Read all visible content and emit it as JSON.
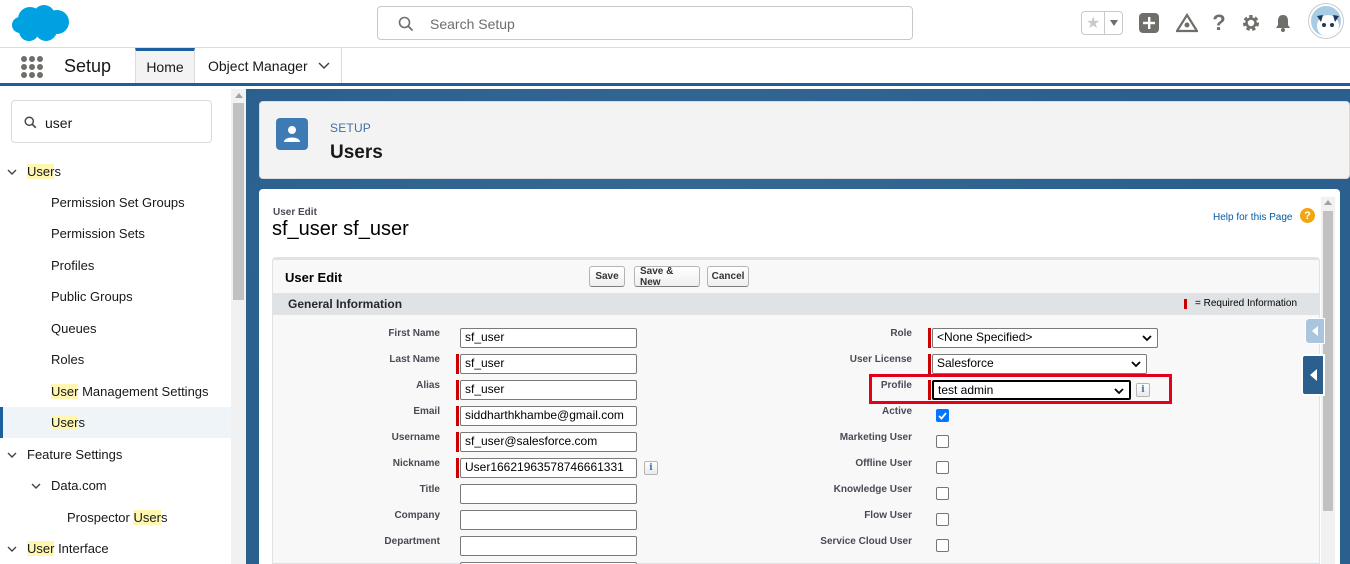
{
  "header": {
    "search_placeholder": "Search Setup",
    "icons": [
      "favorites-star-icon",
      "add-icon",
      "trailhead-icon",
      "help-icon",
      "gear-icon",
      "bell-icon",
      "avatar"
    ]
  },
  "nav": {
    "app_name": "Setup",
    "tabs": [
      {
        "label": "Home",
        "active": true
      },
      {
        "label": "Object Manager",
        "active": false
      }
    ]
  },
  "sidebar": {
    "search_value": "user",
    "items": [
      {
        "label_hl": "User",
        "label_rest": "s",
        "level": 0,
        "expanded": true
      },
      {
        "label": "Permission Set Groups",
        "level": 1
      },
      {
        "label": "Permission Sets",
        "level": 1
      },
      {
        "label": "Profiles",
        "level": 1
      },
      {
        "label": "Public Groups",
        "level": 1
      },
      {
        "label": "Queues",
        "level": 1
      },
      {
        "label": "Roles",
        "level": 1
      },
      {
        "label_hl": "User",
        "label_rest": " Management Settings",
        "level": 1
      },
      {
        "label_hl": "User",
        "label_rest": "s",
        "level": 1,
        "active": true
      },
      {
        "label": "Feature Settings",
        "level": 0,
        "expanded": true
      },
      {
        "label": "Data.com",
        "level": 1,
        "expanded": true
      },
      {
        "label_pre": "Prospector ",
        "label_hl": "User",
        "label_rest": "s",
        "level": 2
      },
      {
        "label_hl": "User",
        "label_rest": " Interface",
        "level": 0,
        "expanded": true
      }
    ]
  },
  "page_header": {
    "eyebrow": "SETUP",
    "title": "Users"
  },
  "form": {
    "subtitle": "User Edit",
    "name": "sf_user sf_user",
    "help_link": "Help for this Page",
    "block_title": "User Edit",
    "buttons": {
      "save": "Save",
      "save_new": "Save & New",
      "cancel": "Cancel"
    },
    "section_title": "General Information",
    "required_info": "= Required Information",
    "left_fields": [
      {
        "label": "First Name",
        "value": "sf_user",
        "required": false
      },
      {
        "label": "Last Name",
        "value": "sf_user",
        "required": true
      },
      {
        "label": "Alias",
        "value": "sf_user",
        "required": true
      },
      {
        "label": "Email",
        "value": "siddharthkhambe@gmail.com",
        "required": true
      },
      {
        "label": "Username",
        "value": "sf_user@salesforce.com",
        "required": true
      },
      {
        "label": "Nickname",
        "value": "User16621963578746661331",
        "required": true,
        "info": true
      },
      {
        "label": "Title",
        "value": "",
        "required": false
      },
      {
        "label": "Company",
        "value": "",
        "required": false
      },
      {
        "label": "Department",
        "value": "",
        "required": false
      }
    ],
    "right_fields": {
      "role": {
        "label": "Role",
        "value": "<None Specified>"
      },
      "user_license": {
        "label": "User License",
        "value": "Salesforce"
      },
      "profile": {
        "label": "Profile",
        "value": "test admin"
      },
      "checkboxes": [
        {
          "label": "Active",
          "checked": true
        },
        {
          "label": "Marketing User",
          "checked": false
        },
        {
          "label": "Offline User",
          "checked": false
        },
        {
          "label": "Knowledge User",
          "checked": false
        },
        {
          "label": "Flow User",
          "checked": false
        },
        {
          "label": "Service Cloud User",
          "checked": false
        }
      ]
    }
  }
}
